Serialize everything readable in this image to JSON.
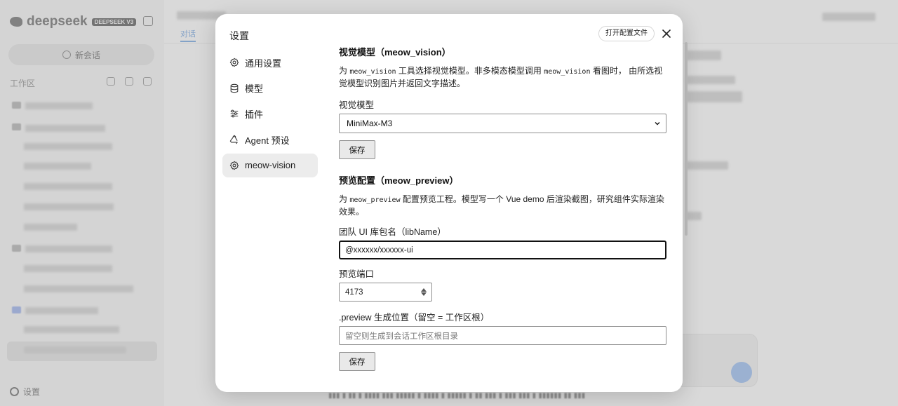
{
  "background": {
    "brand": "deepseek",
    "brand_badge": "DEEPSEEK V3",
    "new_chat_label": "新会话",
    "workspace_label": "工作区",
    "sidebar_footer_label": "设置",
    "main_tab_label": "对话"
  },
  "modal": {
    "title": "设置",
    "open_config_label": "打开配置文件",
    "nav": [
      {
        "label": "通用设置",
        "icon": "gear-icon"
      },
      {
        "label": "模型",
        "icon": "database-icon"
      },
      {
        "label": "插件",
        "icon": "sliders-icon"
      },
      {
        "label": "Agent 预设",
        "icon": "recycle-icon"
      },
      {
        "label": "meow-vision",
        "icon": "gear-icon",
        "active": true
      }
    ],
    "vision": {
      "title": "视觉模型（meow_vision）",
      "desc_1": "为 ",
      "desc_code_1": "meow_vision",
      "desc_2": " 工具选择视觉模型。非多模态模型调用 ",
      "desc_code_2": "meow_vision",
      "desc_3": " 看图时， 由所选视觉模型识别图片并返回文字描述。",
      "field_label": "视觉模型",
      "selected_value": "MiniMax-M3",
      "save_label": "保存"
    },
    "preview": {
      "title": "预览配置（meow_preview）",
      "desc_1": "为 ",
      "desc_code": "meow_preview",
      "desc_2": " 配置预览工程。模型写一个 Vue demo 后渲染截图，研究组件实际渲染效果。",
      "lib_label": "团队 UI 库包名（libName）",
      "lib_value": "@xxxxxx/xxxxxx-ui",
      "port_label": "预览端口",
      "port_value": "4173",
      "location_label": ".preview 生成位置（留空 = 工作区根）",
      "location_placeholder": "留空则生成到会话工作区根目录",
      "save_label": "保存"
    }
  },
  "colors": {
    "overlay": "#000000",
    "accent_blue": "#8fb0d8",
    "active_nav_bg": "#ececec"
  }
}
